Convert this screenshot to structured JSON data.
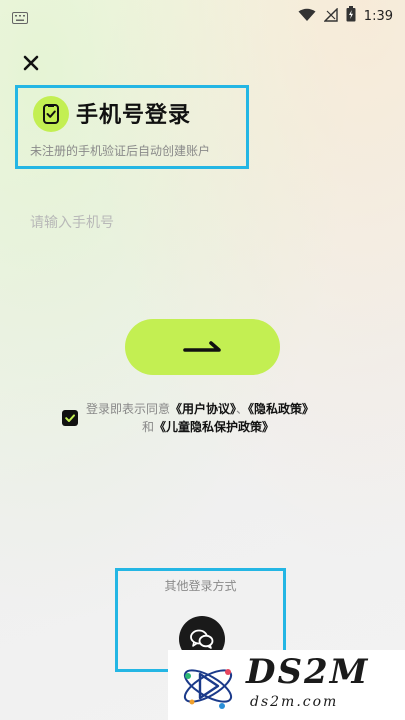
{
  "status_bar": {
    "time": "1:39",
    "icons": [
      "keyboard-icon",
      "wifi-icon",
      "signal-icon",
      "battery-charging-icon"
    ]
  },
  "colors": {
    "accent": "#c3ef52",
    "highlight_box": "#24b6e4",
    "text_primary": "#111111",
    "text_secondary": "#8a8a8a"
  },
  "header": {
    "title": "手机号登录",
    "subtitle": "未注册的手机验证后自动创建账户"
  },
  "form": {
    "phone_value": "",
    "phone_placeholder": "请输入手机号",
    "submit_icon": "arrow-right-icon"
  },
  "agreement": {
    "checked": true,
    "prefix": "登录即表示同意",
    "user_agreement": "《用户协议》",
    "separator": "、",
    "privacy_policy": "《隐私政策》",
    "and": "和",
    "child_privacy": "《儿童隐私保护政策》"
  },
  "other_login": {
    "label": "其他登录方式",
    "wechat_icon": "wechat-icon"
  },
  "watermark": {
    "brand": "DS2M",
    "domain": "ds2m.com"
  }
}
